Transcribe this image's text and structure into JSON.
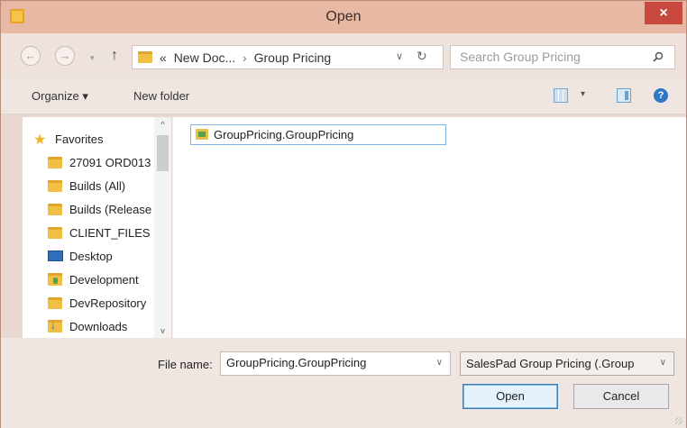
{
  "window": {
    "title": "Open",
    "close_label": "×"
  },
  "nav": {
    "back_glyph": "←",
    "forward_glyph": "→",
    "up_glyph": "↑",
    "address": {
      "prefix": "«",
      "crumbs": [
        "New Doc...",
        "Group Pricing"
      ],
      "separator": "›",
      "dropdown_glyph": "∨",
      "refresh_glyph": "↻"
    },
    "search": {
      "placeholder": "Search Group Pricing",
      "value": ""
    }
  },
  "toolbar": {
    "organize_label": "Organize ▾",
    "new_folder_label": "New folder",
    "view_dropdown_glyph": "▾",
    "help_glyph": "?"
  },
  "sidebar": {
    "favorites_label": "Favorites",
    "items": [
      {
        "label": "27091 ORD013",
        "icon": "folder-icon"
      },
      {
        "label": "Builds (All)",
        "icon": "folder-icon"
      },
      {
        "label": "Builds (Release",
        "icon": "folder-icon"
      },
      {
        "label": "CLIENT_FILES",
        "icon": "folder-icon"
      },
      {
        "label": "Desktop",
        "icon": "desktop-icon"
      },
      {
        "label": "Development",
        "icon": "development-folder-icon"
      },
      {
        "label": "DevRepository",
        "icon": "folder-icon"
      },
      {
        "label": "Downloads",
        "icon": "downloads-icon"
      }
    ],
    "scroll_up_glyph": "^",
    "scroll_down_glyph": "v"
  },
  "files": [
    {
      "name": "GroupPricing.GroupPricing",
      "selected": true
    }
  ],
  "bottom": {
    "file_name_label": "File name:",
    "file_name_value": "GroupPricing.GroupPricing",
    "file_name_dropdown_glyph": "∨",
    "filter_label": "SalesPad Group Pricing (.Group",
    "filter_dropdown_glyph": "∨",
    "open_label": "Open",
    "cancel_label": "Cancel"
  },
  "colors": {
    "titlebar": "#e7b9a4",
    "close_button": "#c7483d",
    "selection_border": "#7fb2e5"
  }
}
